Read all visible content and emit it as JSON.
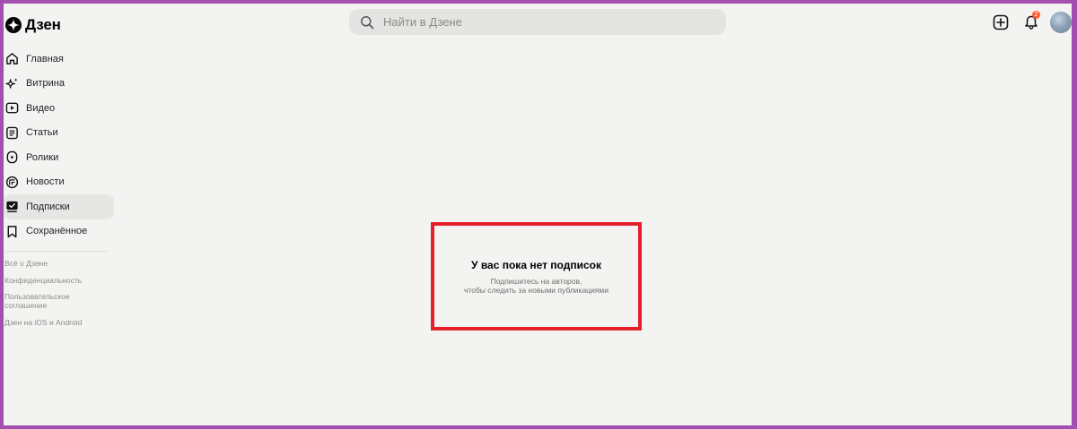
{
  "header": {
    "logo_text": "Дзен",
    "search_placeholder": "Найти в Дзене",
    "notifications_count": "2"
  },
  "sidebar": {
    "items": [
      {
        "label": "Главная",
        "icon": "home-icon"
      },
      {
        "label": "Витрина",
        "icon": "sparkle-icon"
      },
      {
        "label": "Видео",
        "icon": "video-icon"
      },
      {
        "label": "Статьи",
        "icon": "article-icon"
      },
      {
        "label": "Ролики",
        "icon": "clips-icon"
      },
      {
        "label": "Новости",
        "icon": "news-icon"
      },
      {
        "label": "Подписки",
        "icon": "subscriptions-icon",
        "active": true
      },
      {
        "label": "Сохранённое",
        "icon": "bookmark-icon"
      }
    ],
    "footer": {
      "about": "Всё о Дзене",
      "privacy": "Конфиденциальность",
      "terms": "Пользовательское соглашение",
      "apps": "Дзен на iOS и Android"
    }
  },
  "main": {
    "empty_title": "У вас пока нет подписок",
    "empty_subtitle_line1": "Подпишитесь на авторов,",
    "empty_subtitle_line2": "чтобы следить за новыми публикациями"
  },
  "colors": {
    "background": "#f3f3f2",
    "frame": "#a24fb0",
    "highlight": "#e51f2b",
    "badge": "#ff5a36"
  }
}
